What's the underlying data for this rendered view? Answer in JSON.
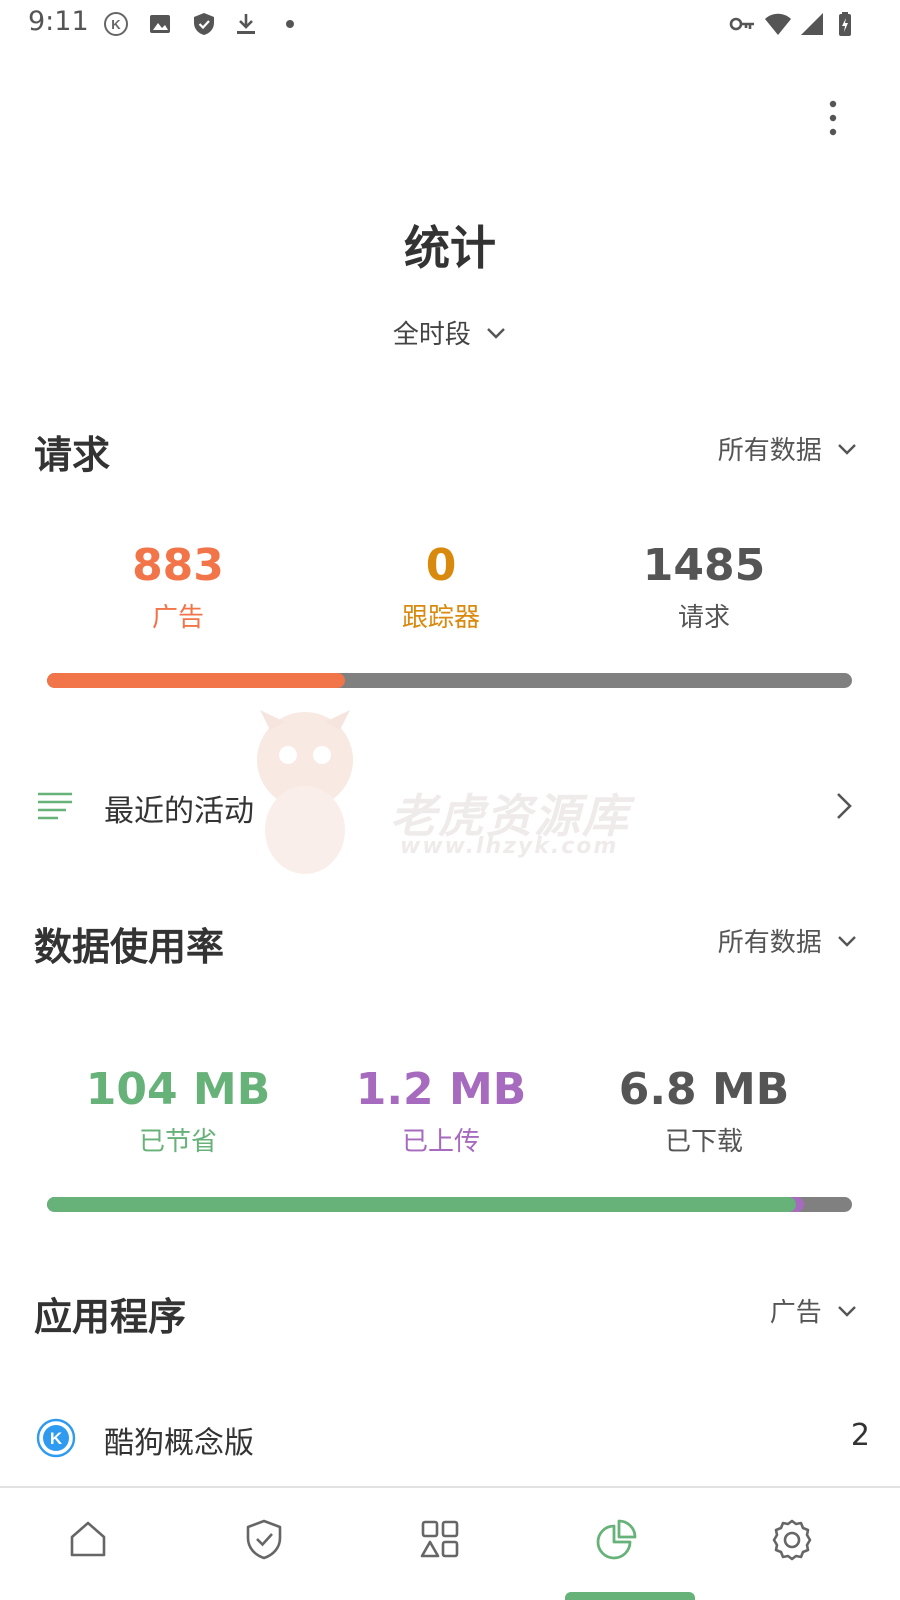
{
  "status_bar": {
    "time": "9:11",
    "left_icons": [
      "k-app-icon",
      "image-icon",
      "shield-icon",
      "download-icon",
      "dot-icon"
    ],
    "right_icons": [
      "key-icon",
      "wifi-icon",
      "signal-icon",
      "battery-icon"
    ]
  },
  "header": {
    "title": "统计",
    "period": "全时段",
    "more_icon": "more-vertical-icon"
  },
  "requests": {
    "title": "请求",
    "filter": "所有数据",
    "stats": [
      {
        "value": "883",
        "label": "广告",
        "color": "#f27449"
      },
      {
        "value": "0",
        "label": "跟踪器",
        "color": "#d98a0e"
      },
      {
        "value": "1485",
        "label": "请求",
        "color": "#555555"
      }
    ],
    "bar": {
      "ads_fraction": 0.37,
      "track_color": "#808080"
    }
  },
  "activity": {
    "label": "最近的活动",
    "icon": "list-icon",
    "chevron": "chevron-right-icon"
  },
  "watermark": {
    "title": "老虎资源库",
    "url": "www.lhzyk.com"
  },
  "data_usage": {
    "title": "数据使用率",
    "filter": "所有数据",
    "stats": [
      {
        "value": "104 MB",
        "label": "已节省",
        "color": "#67b279"
      },
      {
        "value": "1.2 MB",
        "label": "已上传",
        "color": "#a66bbf"
      },
      {
        "value": "6.8 MB",
        "label": "已下载",
        "color": "#555555"
      }
    ],
    "bar": {
      "saved_fraction": 0.93,
      "uploaded_fraction": 0.01
    }
  },
  "apps": {
    "title": "应用程序",
    "filter": "广告",
    "items": [
      {
        "name": "酷狗概念版",
        "count": "2",
        "icon": "kugou-icon"
      }
    ]
  },
  "bottom_nav": {
    "items": [
      {
        "name": "home-icon"
      },
      {
        "name": "protection-icon"
      },
      {
        "name": "apps-icon"
      },
      {
        "name": "statistics-icon",
        "active": true
      },
      {
        "name": "settings-icon"
      }
    ],
    "accent": "#67b279"
  }
}
